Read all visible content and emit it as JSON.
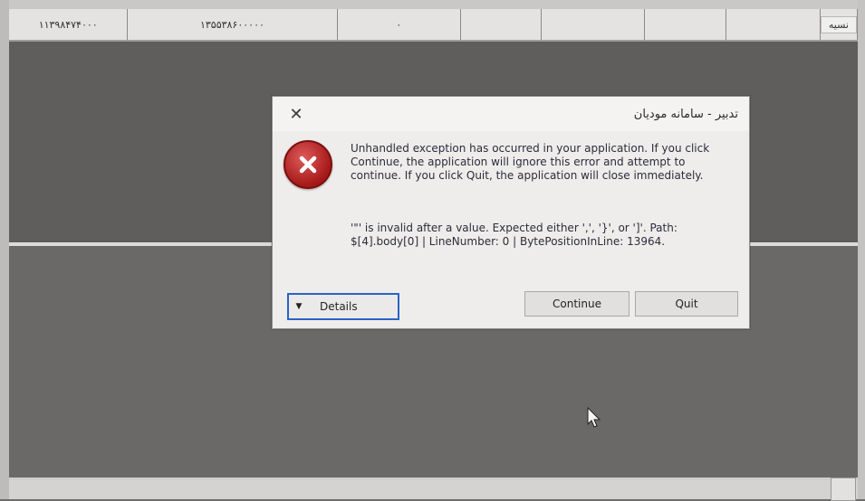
{
  "background_grid": {
    "cells": [
      "۱۱۳۹۸۴۷۴۰۰۰",
      "۱۳۵۵۳۸۶۰۰۰۰۰",
      "۰",
      "",
      "",
      "",
      ""
    ],
    "payment_type": "نسیه"
  },
  "dialog": {
    "title": "تدبیر - سامانه مودیان",
    "close_symbol": "✕",
    "message": "Unhandled exception has occurred in your application. If you click Continue, the application will ignore this error and attempt to continue. If you click Quit, the application will close immediately.",
    "detail": "'\"' is invalid after a value. Expected either ',', '}', or ']'. Path: $[4].body[0] | LineNumber: 0 | BytePositionInLine: 13964.",
    "buttons": {
      "details": "Details",
      "continue": "Continue",
      "quit": "Quit"
    }
  },
  "colors": {
    "error_red": "#b52020",
    "focus_blue": "#2a63c7"
  },
  "icons": {
    "error": "error-circle-icon",
    "details_toggle": "triangle-down-icon",
    "close": "close-icon",
    "cursor": "mouse-pointer-icon"
  }
}
